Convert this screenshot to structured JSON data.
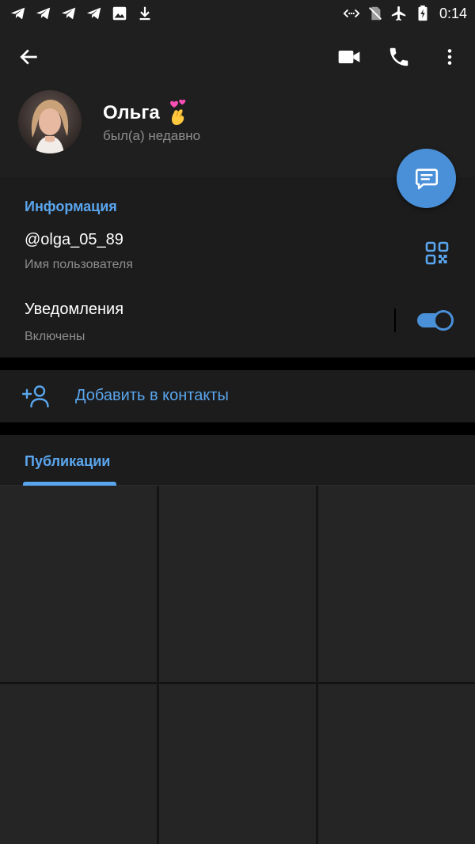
{
  "status_bar": {
    "notifications": [
      "telegram-icon",
      "telegram-icon",
      "telegram-icon",
      "telegram-icon",
      "image-icon",
      "download-icon"
    ],
    "time": "0:14"
  },
  "profile": {
    "name": "Ольга",
    "name_emoji": "🫰💗",
    "last_seen": "был(а) недавно"
  },
  "info": {
    "section_title": "Информация",
    "username": "@olga_05_89",
    "username_label": "Имя пользователя",
    "notifications_title": "Уведомления",
    "notifications_state": "Включены",
    "notifications_enabled": true
  },
  "actions": {
    "add_contact": "Добавить в контакты"
  },
  "tabs": {
    "publications": "Публикации"
  },
  "colors": {
    "accent": "#5aa6ee",
    "fab": "#4a90d9",
    "surface": "#1c1c1c",
    "header": "#1f1f1f",
    "muted_text": "#8d8d8d"
  }
}
